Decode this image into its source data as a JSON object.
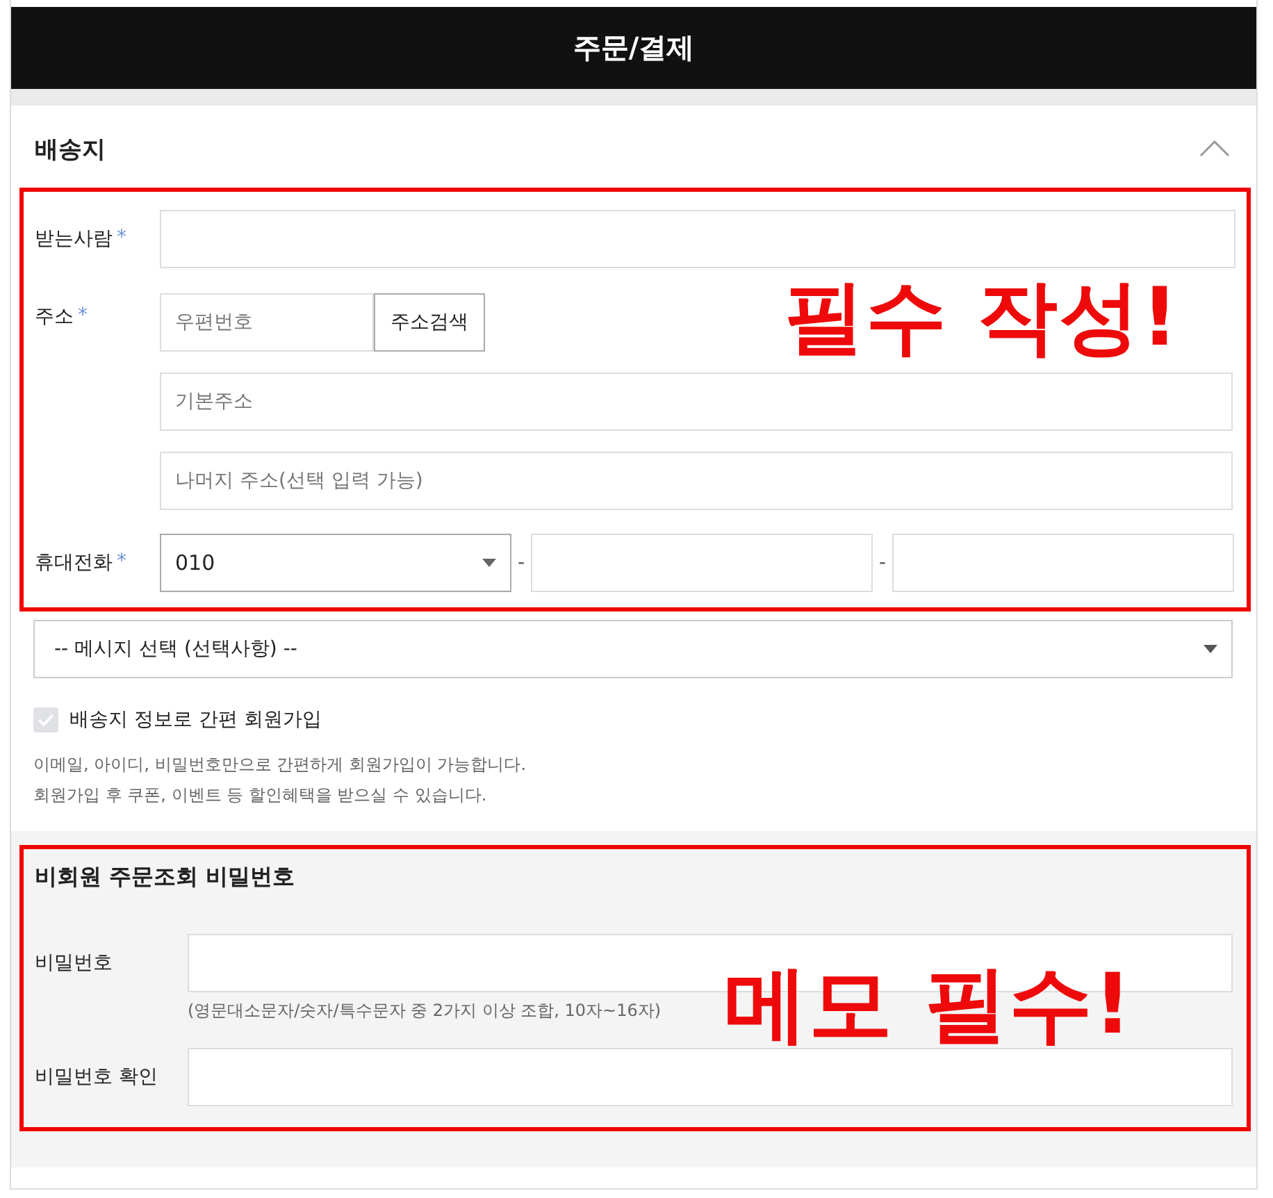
{
  "header": {
    "title": "주문/결제"
  },
  "shipping": {
    "title": "배송지",
    "expanded": true,
    "recipient": {
      "label": "받는사람",
      "required_mark": "*"
    },
    "address": {
      "label": "주소",
      "required_mark": "*",
      "zip_placeholder": "우편번호",
      "search_button": "주소검색",
      "base_placeholder": "기본주소",
      "detail_placeholder": "나머지 주소(선택 입력 가능)"
    },
    "phone": {
      "label": "휴대전화",
      "required_mark": "*",
      "prefix": "010",
      "separators": [
        "-",
        "-"
      ]
    },
    "annotation": "필수 작성!",
    "message_select": "-- 메시지 선택 (선택사항) --",
    "signup": {
      "label": "배송지 정보로 간편 회원가입",
      "checked": true
    },
    "notes": [
      "이메일, 아이디, 비밀번호만으로 간편하게 회원가입이 가능합니다.",
      "회원가입 후 쿠폰, 이벤트 등 할인혜택을 받으실 수 있습니다."
    ]
  },
  "guest_password": {
    "title": "비회원 주문조회 비밀번호",
    "password": {
      "label": "비밀번호",
      "hint": "(영문대소문자/숫자/특수문자 중 2가지 이상 조합, 10자~16자)"
    },
    "confirm": {
      "label": "비밀번호 확인"
    },
    "annotation": "메모 필수!"
  }
}
